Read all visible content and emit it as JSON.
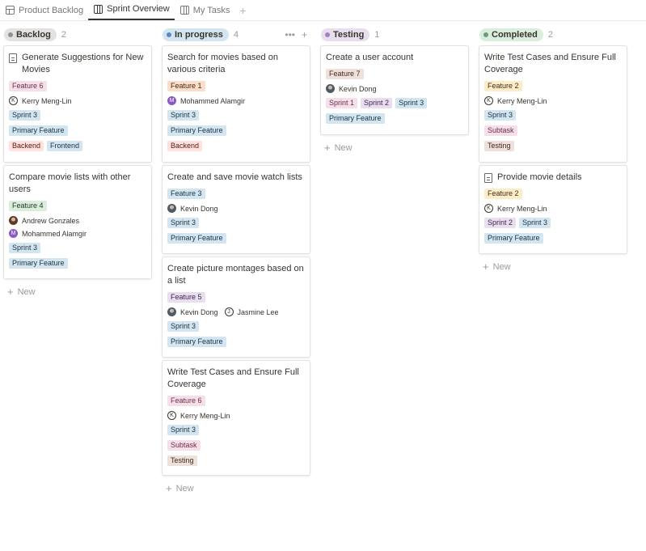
{
  "tabs": [
    {
      "label": "Product Backlog",
      "icon": "table-icon"
    },
    {
      "label": "Sprint Overview",
      "icon": "board-icon"
    },
    {
      "label": "My Tasks",
      "icon": "board-icon"
    }
  ],
  "new_label": "New",
  "colors": {
    "backlog_bg": "#e3e2e0",
    "backlog_dot": "#91918e",
    "progress_bg": "#d3e5ef",
    "progress_dot": "#5e87c9",
    "testing_bg": "#e8deee",
    "testing_dot": "#a67ec4",
    "completed_bg": "#dbeddb",
    "completed_dot": "#6c9b7d",
    "tag_red": "#ffe2dd",
    "tag_orange": "#fadec9",
    "tag_yellow": "#fdecc8",
    "tag_green": "#dbeddb",
    "tag_blue": "#d3e5ef",
    "tag_purple": "#e8deee",
    "tag_pink": "#f5e0e9",
    "tag_brown": "#eee0da"
  },
  "columns": [
    {
      "name": "Backlog",
      "count": "2",
      "cards": [
        {
          "title": "Generate Suggestions for New Movies",
          "feature": "Feature 6",
          "people": [
            {
              "name": "Kerry Meng-Lin",
              "initial": "K"
            }
          ],
          "sprints": [
            "Sprint 3"
          ],
          "type": "Primary Feature",
          "tags": [
            "Backend",
            "Frontend"
          ]
        },
        {
          "title": "Compare movie lists with other users",
          "feature": "Feature 4",
          "people": [
            {
              "name": "Andrew Gonzales"
            },
            {
              "name": "Mohammed Alamgir",
              "initial": "M"
            }
          ],
          "sprints": [
            "Sprint 3"
          ],
          "type": "Primary Feature"
        }
      ]
    },
    {
      "name": "In progress",
      "count": "4",
      "cards": [
        {
          "title": "Search for movies based on various criteria",
          "feature": "Feature 1",
          "people": [
            {
              "name": "Mohammed Alamgir",
              "initial": "M"
            }
          ],
          "sprints": [
            "Sprint 3"
          ],
          "type": "Primary Feature",
          "tags": [
            "Backend"
          ]
        },
        {
          "title": "Create and save movie watch lists",
          "feature": "Feature 3",
          "people": [
            {
              "name": "Kevin Dong"
            }
          ],
          "sprints": [
            "Sprint 3"
          ],
          "type": "Primary Feature"
        },
        {
          "title": "Create picture montages based on a list",
          "feature": "Feature 5",
          "people": [
            {
              "name": "Kevin Dong"
            },
            {
              "name": "Jasmine Lee",
              "initial": "J"
            }
          ],
          "sprints": [
            "Sprint 3"
          ],
          "type": "Primary Feature"
        },
        {
          "title": "Write Test Cases and Ensure Full Coverage",
          "feature": "Feature 6",
          "people": [
            {
              "name": "Kerry Meng-Lin",
              "initial": "K"
            }
          ],
          "sprints": [
            "Sprint 3"
          ],
          "type": "Subtask",
          "tags": [
            "Testing"
          ]
        }
      ]
    },
    {
      "name": "Testing",
      "count": "1",
      "cards": [
        {
          "title": "Create a user account",
          "feature": "Feature 7",
          "people": [
            {
              "name": "Kevin Dong"
            }
          ],
          "sprints": [
            "Sprint 1",
            "Sprint 2",
            "Sprint 3"
          ],
          "type": "Primary Feature"
        }
      ]
    },
    {
      "name": "Completed",
      "count": "2",
      "cards": [
        {
          "title": "Write Test Cases and Ensure Full Coverage",
          "feature": "Feature 2",
          "people": [
            {
              "name": "Kerry Meng-Lin",
              "initial": "K"
            }
          ],
          "sprints": [
            "Sprint 3"
          ],
          "type": "Subtask",
          "tags": [
            "Testing"
          ]
        },
        {
          "title": "Provide movie details",
          "feature": "Feature 2",
          "people": [
            {
              "name": "Kerry Meng-Lin",
              "initial": "K"
            }
          ],
          "sprints": [
            "Sprint 2",
            "Sprint 3"
          ],
          "type": "Primary Feature"
        }
      ]
    }
  ]
}
